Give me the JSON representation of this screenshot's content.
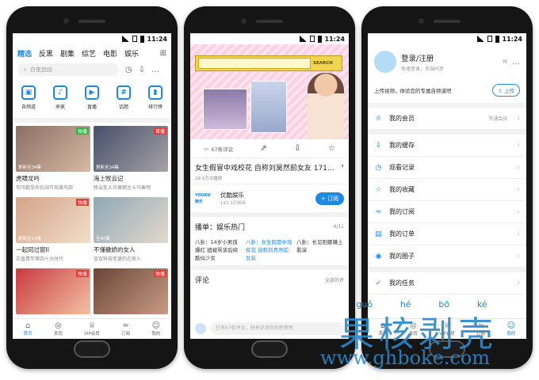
{
  "status": {
    "time": "11:24"
  },
  "home": {
    "tabs": [
      "精选",
      "反黑",
      "剧集",
      "综艺",
      "电影",
      "娱乐"
    ],
    "active_tab": 0,
    "search_placeholder": "白夜追凶",
    "categories": [
      {
        "label": "自频道",
        "icon": "channel-icon",
        "glyph": "▣"
      },
      {
        "label": "来疯",
        "icon": "laifeng-icon",
        "glyph": "♪"
      },
      {
        "label": "直播",
        "icon": "live-icon",
        "glyph": "▶"
      },
      {
        "label": "话题",
        "icon": "topic-icon",
        "glyph": "#"
      },
      {
        "label": "排行榜",
        "icon": "ranking-icon",
        "glyph": "▮"
      }
    ],
    "cards": [
      {
        "title": "虎啸龙吟",
        "sub": "司马懿受命抗战开局落马部",
        "badge": "独播",
        "badge_color": "green",
        "overlay": "更新至34集",
        "color1": "#8b6f63",
        "color2": "#d6b8a4"
      },
      {
        "title": "海上牧云记",
        "sub": "牧云笙入华黄朝主斗乌秦明",
        "badge": "首播",
        "badge_color": "red",
        "overlay": "更新至34集",
        "color1": "#47506a",
        "color2": "#a6a1a6"
      },
      {
        "title": "一起同过窗II",
        "sub": "正直青年第四十大时代",
        "badge": "独播",
        "badge_color": "red",
        "overlay": "更新至14集",
        "color1": "#d4a488",
        "color2": "#f1ddc9"
      },
      {
        "title": "不懂撒娇的女人",
        "sub": "宣宣科技老婆的在家人",
        "badge": "",
        "badge_color": "",
        "overlay": "全40集",
        "color1": "#8fa8b6",
        "color2": "#e2d8cc"
      },
      {
        "title": "",
        "sub": "",
        "badge": "独播",
        "badge_color": "red",
        "overlay": "",
        "color1": "#c83a3f",
        "color2": "#f3c1a5"
      },
      {
        "title": "",
        "sub": "",
        "badge": "独播",
        "badge_color": "red",
        "overlay": "",
        "color1": "#6a4638",
        "color2": "#c99b83"
      }
    ],
    "nav": [
      {
        "label": "首页",
        "icon": "home-icon",
        "glyph": "⌂"
      },
      {
        "label": "发现",
        "icon": "discover-icon",
        "glyph": "◎"
      },
      {
        "label": "VIP会员",
        "icon": "vip-icon",
        "glyph": "♕"
      },
      {
        "label": "订阅",
        "icon": "subscribe-icon",
        "glyph": "≈"
      },
      {
        "label": "我的",
        "icon": "profile-icon",
        "glyph": "☺"
      }
    ]
  },
  "video": {
    "banner_search_label": "SEARCH",
    "comment_count": "67条评论",
    "title": "女生假冒中戏校花 自称刘昊然前女友 171...",
    "meta": "29.1万次播放",
    "channel_name": "优酷娱乐",
    "channel_logo": "YOUKU 娱乐",
    "channel_subs": "142.3万粉丝",
    "subscribe_label": "+ 订阅",
    "playlist_title": "播单：娱乐热门",
    "playlist_page": "4/11",
    "playlist": [
      {
        "text": "八卦：14岁小男孩爆红 妞被骂该后续酷似少女",
        "active": false
      },
      {
        "text": "八卦：女生假冒中戏校花 自称刘昊然前女友",
        "active": true
      },
      {
        "text": "八卦：长见阳娜嫌上看演",
        "active": false
      }
    ],
    "comments_title": "评论",
    "comments_all": "全部的评",
    "comment_placeholder": "已有67条评论，快来说说你的感想吧"
  },
  "profile": {
    "login_title": "登录/注册",
    "login_sub": "快速登录，多端同步",
    "upload_text": "上传视频，体验您的专属自频道吧",
    "upload_button": "上传",
    "menu": [
      {
        "label": "我的会员",
        "right": "开通会员",
        "icon": "member-icon",
        "glyph": "♕"
      },
      {
        "label": "我的缓存",
        "right": "",
        "icon": "cache-icon",
        "glyph": "⇩"
      },
      {
        "label": "观看记录",
        "right": "",
        "icon": "history-icon",
        "glyph": "◷"
      },
      {
        "label": "我的收藏",
        "right": "",
        "icon": "favorite-icon",
        "glyph": "☆"
      },
      {
        "label": "我的订阅",
        "right": "",
        "icon": "subscription-icon",
        "glyph": "≈"
      },
      {
        "label": "我的订单",
        "right": "",
        "icon": "order-icon",
        "glyph": "▤"
      },
      {
        "label": "我的圈子",
        "right": "",
        "icon": "circle-icon",
        "glyph": "◉"
      },
      {
        "label": "我的任务",
        "right": "",
        "icon": "task-icon",
        "glyph": "✓"
      }
    ],
    "nav_active_label": "我的"
  },
  "watermark": {
    "pinyin": [
      "guǒ",
      "hé",
      "bō",
      "ké"
    ],
    "chinese": "果核剥壳",
    "url": "www.ghboke.com"
  }
}
